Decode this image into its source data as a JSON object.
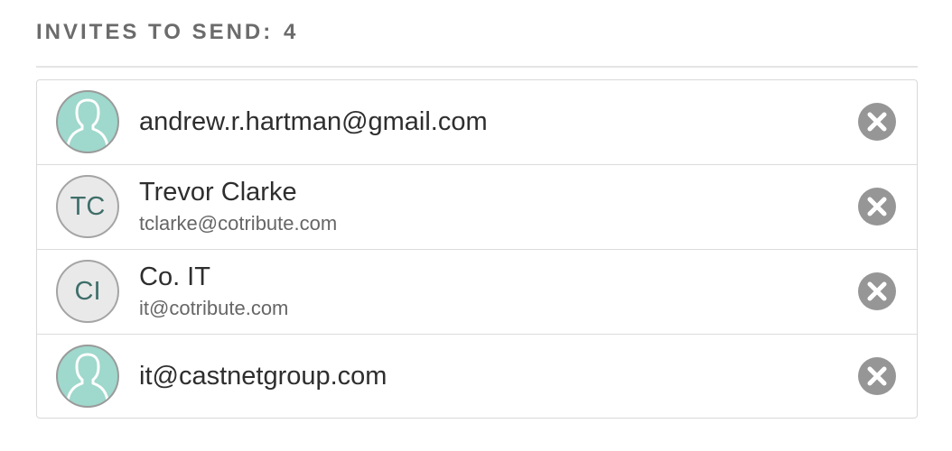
{
  "header": {
    "label": "INVITES TO SEND:",
    "count": "4"
  },
  "invites": [
    {
      "avatar_type": "photo-placeholder",
      "avatar_icon": "user-silhouette-icon",
      "primary": "andrew.r.hartman@gmail.com"
    },
    {
      "avatar_type": "initials",
      "initials": "TC",
      "primary": "Trevor Clarke",
      "secondary": "tclarke@cotribute.com"
    },
    {
      "avatar_type": "initials",
      "initials": "CI",
      "primary": "Co. IT",
      "secondary": "it@cotribute.com"
    },
    {
      "avatar_type": "photo-placeholder",
      "avatar_icon": "user-silhouette-icon",
      "primary": "it@castnetgroup.com"
    }
  ],
  "remove_icon": "close-circle-icon",
  "colors": {
    "avatar_photo_bg": "#9fd8cc",
    "avatar_initials_bg": "#e9e9e9",
    "initials_text": "#3f6e6a",
    "remove_button": "#969696"
  }
}
